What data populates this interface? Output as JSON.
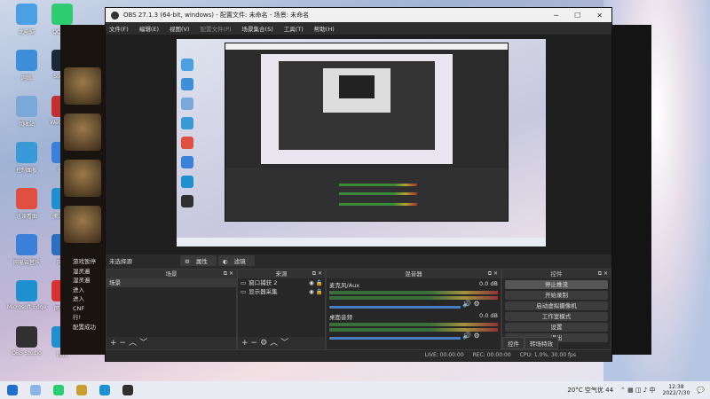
{
  "desktop": {
    "left_icons": [
      {
        "label": "此电脑",
        "color": "#4aa0e0"
      },
      {
        "label": "网络",
        "color": "#3c8fd8"
      },
      {
        "label": "回收站",
        "color": "#7aa8d8"
      },
      {
        "label": "控制面板",
        "color": "#3a9ad8"
      },
      {
        "label": "迅读看图",
        "color": "#e05040"
      },
      {
        "label": "网易云音乐",
        "color": "#3a7fd8"
      },
      {
        "label": "Microsoft Edge",
        "color": "#1e90d0"
      },
      {
        "label": "OBS Studio",
        "color": "#303030"
      }
    ],
    "second_icons": [
      {
        "label": "QQ音乐",
        "color": "#2ecc71"
      },
      {
        "label": "Steam",
        "color": "#1b2838"
      },
      {
        "label": "WeGame",
        "color": "#c43030"
      },
      {
        "label": "千牛",
        "color": "#3a7fd8"
      },
      {
        "label": "腾讯QQ",
        "color": "#1e90d0"
      },
      {
        "label": "网易",
        "color": "#2a6fc0"
      },
      {
        "label": "网易云",
        "color": "#d93030"
      },
      {
        "label": "腾讯",
        "color": "#1e90d0"
      }
    ]
  },
  "game_chat": [
    "游戏暂停",
    "湿灵遍",
    "湿灵遍",
    "进入",
    "进入",
    "CNF",
    "行!",
    "配置成功"
  ],
  "obs": {
    "title": "OBS 27.1.3 (64-bit, windows) - 配置文件: 未命名 - 场景: 未命名",
    "menu": [
      "文件(F)",
      "编辑(E)",
      "视图(V)",
      "配置文件(P)",
      "场景集合(S)",
      "工具(T)",
      "帮助(H)"
    ],
    "scene_label": "未选择源",
    "properties_btn": "属性",
    "filters_btn": "滤镜",
    "docks": {
      "scenes": {
        "title": "场景",
        "items": [
          "场景"
        ]
      },
      "sources": {
        "title": "来源",
        "items": [
          "窗口捕获 2",
          "显示器采集"
        ]
      },
      "mixer": {
        "title": "混音器",
        "channels": [
          {
            "name": "麦克风/Aux",
            "db": "0.0 dB"
          },
          {
            "name": "桌面音频",
            "db": "0.0 dB"
          }
        ]
      },
      "controls": {
        "title": "控件",
        "buttons": [
          "停止推流",
          "开始录制",
          "启动虚拟摄像机",
          "工作室模式",
          "设置",
          "退出"
        ],
        "tabs": [
          "控件",
          "转场特效"
        ]
      }
    },
    "status": {
      "live": "LIVE: 00:00:00",
      "rec": "REC: 00:00:00",
      "cpu": "CPU: 1.0%, 30.00 fps"
    }
  },
  "taskbar": {
    "weather": "20°C 空气优 44",
    "time": "12:38",
    "date": "2022/7/30"
  }
}
